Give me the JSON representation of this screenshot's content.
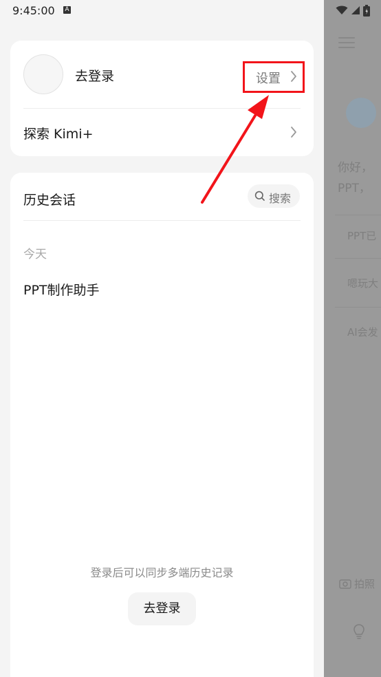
{
  "status_bar": {
    "time": "9:45:00",
    "a_icon_letter": "A"
  },
  "profile": {
    "login_label": "去登录",
    "settings_label": "设置"
  },
  "explore": {
    "label": "探索 Kimi+"
  },
  "history": {
    "title": "历史会话",
    "search_label": "搜索",
    "section_today": "今天",
    "items": [
      "PPT制作助手"
    ],
    "sync_tip": "登录后可以同步多端历史记录",
    "login_button": "去登录"
  },
  "background_chat": {
    "greeting_line1": "你好，",
    "greeting_line2": "PPT，",
    "suggestion_1": "PPT已",
    "suggestion_2": "嗯玩大",
    "suggestion_3": "AI会发",
    "bottom_action": "拍照"
  },
  "colors": {
    "highlight_red": "#f2141a",
    "card_bg": "#ffffff",
    "page_bg": "#f4f4f4",
    "overlay_bg": "#9a9a9a"
  }
}
